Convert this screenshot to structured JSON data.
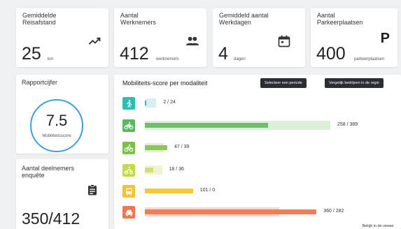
{
  "stats": [
    {
      "label": "Gemiddelde\nReisafstand",
      "value": "25",
      "unit": "km",
      "icon": "trending-up-icon"
    },
    {
      "label": "Aantal\nWerknemers",
      "value": "412",
      "unit": "werknemers",
      "icon": "people-icon"
    },
    {
      "label": "Gemiddeld aantal\nWerkdagen",
      "value": "4",
      "unit": "dagen",
      "icon": "calendar-icon"
    },
    {
      "label": "Aantal\nParkeerplaatsen",
      "value": "400",
      "unit": "parkeerplaatsen",
      "icon": "parking-icon"
    }
  ],
  "rapport": {
    "title": "Rapportcijfer",
    "value": "7.5",
    "sublabel": "Mobiliteitsscore"
  },
  "enquete": {
    "title": "Aantal deelnemers\nenquête",
    "value": "350/412",
    "icon": "clipboard-icon"
  },
  "chart": {
    "title": "Mobiliteits-score per modaliteit",
    "btn_period": "Selecteer een periode",
    "btn_compare": "Vergelijk bedrijven in de regio",
    "footer": "Bekijk in de viewer",
    "rows": [
      {
        "icon": "walking-icon",
        "label": "2 / 24",
        "fg": 2,
        "bg": 24,
        "color": "#2bbfb3",
        "fg_color": "#2bbfb3",
        "bg_color": "#d6eef0"
      },
      {
        "icon": "bicycle-icon",
        "label": "258 / 389",
        "fg": 258,
        "bg": 389,
        "color": "#5cb85c",
        "fg_color": "#6cc06c",
        "bg_color": "#dcefd8"
      },
      {
        "icon": "e-bike-icon",
        "label": "47 / 39",
        "fg": 47,
        "bg": 39,
        "color": "#7bc142",
        "fg_color": "#8cc65a",
        "bg_color": "#e1efcf"
      },
      {
        "icon": "scooter-icon",
        "label": "18 / 36",
        "fg": 18,
        "bg": 36,
        "color": "#c5d94a",
        "fg_color": "#d4e06b",
        "bg_color": "#eef3d2"
      },
      {
        "icon": "bus-icon",
        "label": "101 / 0",
        "fg": 101,
        "bg": 0,
        "color": "#f5c22c",
        "fg_color": "#f7c83a",
        "bg_color": "#fbedc2"
      },
      {
        "icon": "car-icon",
        "label": "360 / 282",
        "fg": 360,
        "bg": 282,
        "color": "#ee7752",
        "fg_color": "#ef7d58",
        "bg_color": "#f9d6c8"
      }
    ]
  }
}
